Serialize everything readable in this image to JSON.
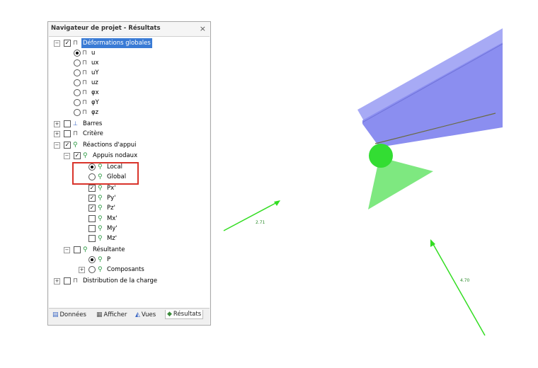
{
  "navigator": {
    "title": "Navigateur de projet - Résultats",
    "close": "×",
    "items": {
      "deformations": "Déformations globales",
      "u": "u",
      "ux": "ux",
      "uy": "uY",
      "uz": "uz",
      "phix": "φx",
      "phiy": "φY",
      "phiz": "φz",
      "barres": "Barres",
      "critere": "Critère",
      "reactions": "Réactions d'appui",
      "appuis": "Appuis nodaux",
      "local": "Local",
      "global": "Global",
      "px": "Px'",
      "py": "Py'",
      "pz": "Pz'",
      "mx": "Mx'",
      "my": "My'",
      "mz": "Mz'",
      "resultante": "Résultante",
      "p": "P",
      "composants": "Composants",
      "distribution": "Distribution de la charge"
    },
    "tabs": {
      "donnees": "Données",
      "afficher": "Afficher",
      "vues": "Vues",
      "resultats": "Résultats"
    }
  },
  "viewport": {
    "arrow_left_value": "2.71",
    "arrow_right_value": "4.70",
    "beam_color": "#8b8ef0",
    "support_color": "#7ee880",
    "node_color": "#33dd33",
    "arrow_color": "#33dd22"
  }
}
